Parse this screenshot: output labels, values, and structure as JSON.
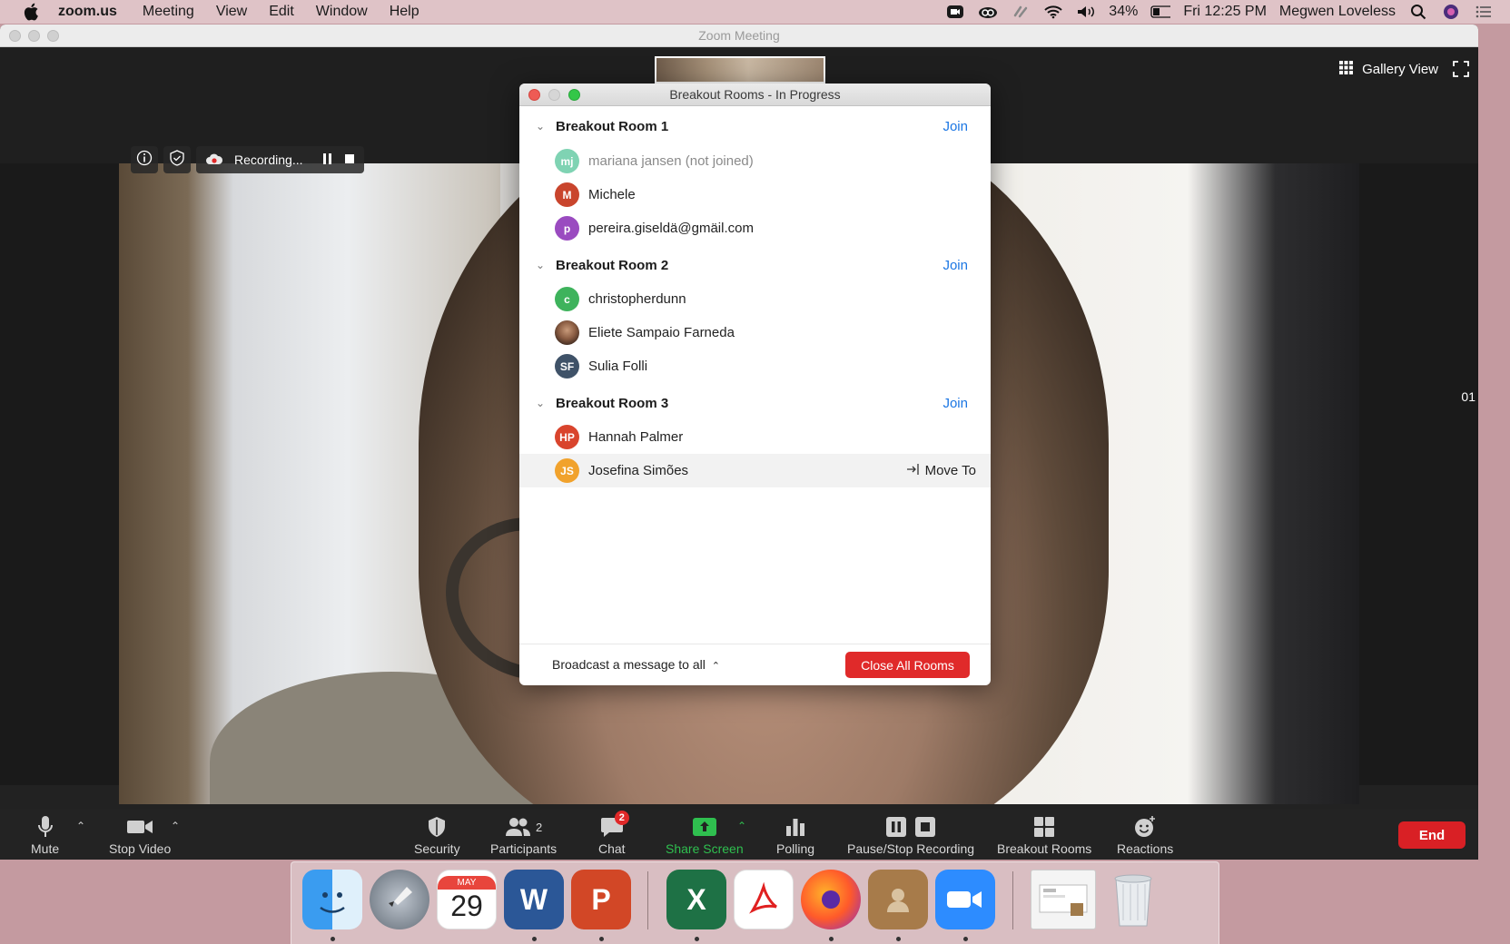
{
  "menubar": {
    "app_name": "zoom.us",
    "menus": [
      "Meeting",
      "View",
      "Edit",
      "Window",
      "Help"
    ],
    "battery": "34%",
    "clock": "Fri 12:25 PM",
    "user": "Megwen Loveless"
  },
  "window": {
    "title": "Zoom Meeting",
    "gallery_view_label": "Gallery View",
    "right_edge_label": "01"
  },
  "recording": {
    "label": "Recording..."
  },
  "breakout": {
    "title": "Breakout Rooms - In Progress",
    "join_label": "Join",
    "move_to_label": "Move To",
    "rooms": [
      {
        "name": "Breakout Room 1",
        "members": [
          {
            "initials": "mj",
            "name": "mariana jansen (not joined)",
            "color": "#7fd3b3",
            "dim": true
          },
          {
            "initials": "M",
            "name": "Michele",
            "color": "#c9452d"
          },
          {
            "initials": "p",
            "name": "pereira.giseldä@gmäil.com",
            "color": "#9a4bc0"
          }
        ]
      },
      {
        "name": "Breakout Room 2",
        "members": [
          {
            "initials": "c",
            "name": "christopherdunn",
            "color": "#3eb35c"
          },
          {
            "initials": "",
            "name": "Eliete Sampaio Farneda",
            "color": "#6b4a3a"
          },
          {
            "initials": "SF",
            "name": "Sulia Folli",
            "color": "#3f5268"
          }
        ]
      },
      {
        "name": "Breakout Room 3",
        "members": [
          {
            "initials": "HP",
            "name": "Hannah Palmer",
            "color": "#d9442d"
          },
          {
            "initials": "JS",
            "name": "Josefina Simões",
            "color": "#f1a22c"
          }
        ]
      }
    ],
    "broadcast_label": "Broadcast a message to all",
    "close_all_label": "Close All Rooms"
  },
  "toolbar": {
    "mute": "Mute",
    "stop_video": "Stop Video",
    "security": "Security",
    "participants": "Participants",
    "participants_count": "2",
    "chat": "Chat",
    "chat_badge": "2",
    "share_screen": "Share Screen",
    "polling": "Polling",
    "pause_stop_recording": "Pause/Stop Recording",
    "breakout_rooms": "Breakout Rooms",
    "reactions": "Reactions",
    "end": "End"
  },
  "dock": {
    "calendar_month": "MAY",
    "calendar_day": "29",
    "apps": [
      "finder-icon",
      "launchpad-icon",
      "calendar-icon",
      "word-icon",
      "powerpoint-icon",
      "excel-icon",
      "acrobat-icon",
      "firefox-icon",
      "contacts-icon",
      "zoom-icon",
      "screenshot-icon",
      "trash-icon"
    ]
  },
  "colors": {
    "accent_blue": "#1b76e3",
    "end_red": "#d92025",
    "share_green": "#2fbf4f"
  }
}
